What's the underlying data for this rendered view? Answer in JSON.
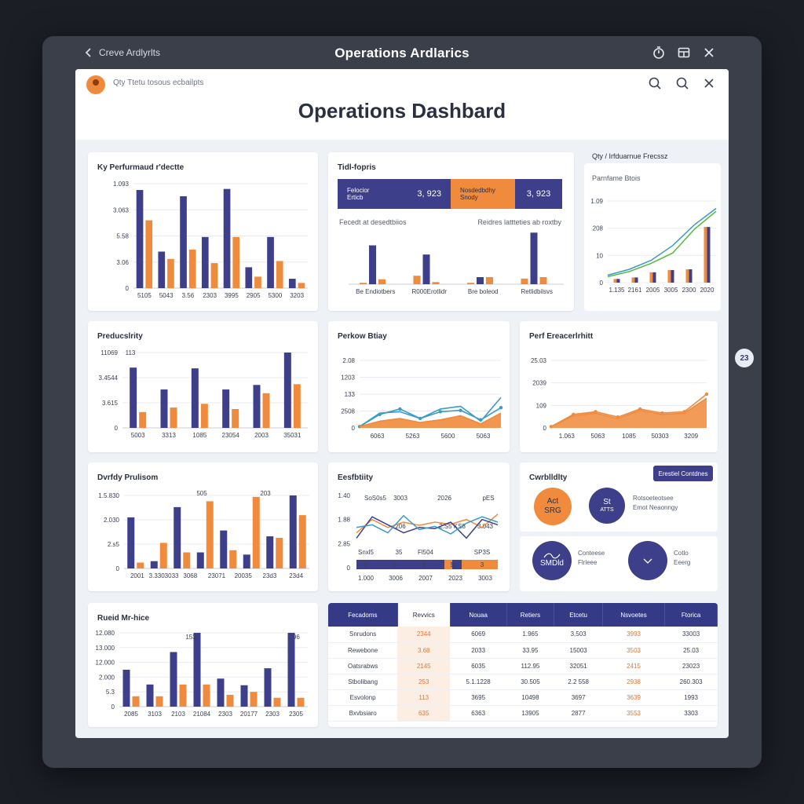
{
  "window": {
    "back_label": "Creve Ardlyrlts",
    "title": "Operations Ardlarics",
    "side_badge": "23"
  },
  "header": {
    "user_text": "Qty Ttetu tosous ecbailpts",
    "title": "Operations Dashbard"
  },
  "colors": {
    "navy": "#3d3f8a",
    "orange": "#f08a3c",
    "teal": "#3a9cc4",
    "green": "#58b83e",
    "window": "#3a3f4a",
    "canvas": "#eef1f6"
  },
  "panels": {
    "kpi": {
      "title": "Ky Perfurmaud r'dectte"
    },
    "tidl": {
      "title": "Tidl-fopris",
      "stat1_label": "Felocior\nErticb",
      "stat1_value": "3, 923",
      "stat2_label": "Nosdedbdhy\nSnody",
      "stat2_value": "3, 923",
      "sub_left": "Fecedt at desedtbiios",
      "sub_right": "Reidres lattteties ab roxtby"
    },
    "perf": {
      "header": "Qty / Irfduarnue Frecssz",
      "title": "Parnfame Btois"
    },
    "productivity": {
      "title": "Preducslrity"
    },
    "perkow": {
      "title": "Perkow Btiay"
    },
    "perfbreak": {
      "title": "Perf Ereacerlrhitt"
    },
    "dvridy": {
      "title": "Dvrfdy Prulisom"
    },
    "eesfoity": {
      "title": "Eesfbtiity"
    },
    "cwrbility": {
      "title": "Cwrblldlty",
      "button": "Erestiel Contdnes",
      "c1_line1": "Act",
      "c1_line2": "SRG",
      "c2_line1": "St",
      "c2_line2": "ATTS",
      "c2_text1": "Rotsoeteotsee",
      "c2_text2": "Emot Neaonngy",
      "c3_line1": "SMDld",
      "c3_text1": "Conteese",
      "c3_text2": "Flrleee",
      "c4_text1": "Cotlo",
      "c4_text2": "Eeerg"
    },
    "rued": {
      "title": "Rueid Mr-hice"
    }
  },
  "charts": [
    {
      "id": "kpi",
      "type": "bar",
      "yticks": [
        "1.093",
        "3.063",
        "5.58",
        "3.06",
        "0"
      ],
      "categories": [
        "5105",
        "5043",
        "3.56",
        "2303",
        "3995",
        "2905",
        "5300",
        "3203"
      ],
      "series": [
        {
          "values": [
            94,
            35,
            88,
            49,
            95,
            20,
            49,
            9
          ]
        },
        {
          "values": [
            65,
            28,
            37,
            24,
            49,
            11,
            26,
            5
          ]
        }
      ],
      "ylim": [
        0,
        100
      ]
    },
    {
      "id": "tidl",
      "type": "bar",
      "categories": [
        "Be Endiotbers",
        "R000Erotlidr",
        "Bre boleod",
        "Retlidbilsvs"
      ],
      "series": [
        {
          "values": [
            2,
            12,
            2,
            8
          ]
        },
        {
          "values": [
            55,
            42,
            10,
            73
          ]
        },
        {
          "values": [
            7,
            3,
            10,
            10
          ]
        }
      ],
      "ylim": [
        0,
        80
      ]
    },
    {
      "id": "perf",
      "type": "line+bar",
      "yticks": [
        "1.09",
        "208",
        "10",
        "0"
      ],
      "categories": [
        "1.135",
        "2161",
        "2005",
        "3005",
        "2300",
        "2020"
      ],
      "line_series": [
        {
          "values": [
            10,
            18,
            30,
            50,
            78,
            100
          ]
        },
        {
          "values": [
            8,
            15,
            26,
            40,
            72,
            96
          ]
        }
      ],
      "bar_series": [
        {
          "values": [
            5,
            7,
            14,
            17,
            18,
            75
          ]
        },
        {
          "values": [
            5,
            7,
            14,
            17,
            18,
            75
          ]
        }
      ],
      "ylim": [
        0,
        110
      ]
    },
    {
      "id": "productivity",
      "type": "bar",
      "yticks": [
        "11069",
        "3.4544",
        "3.615",
        "0"
      ],
      "extra_label": "113",
      "categories": [
        "5003",
        "3313",
        "1085",
        "23054",
        "2003",
        "35031"
      ],
      "series": [
        {
          "values": [
            80,
            51,
            79,
            51,
            57,
            100
          ]
        },
        {
          "values": [
            21,
            27,
            32,
            25,
            46,
            58
          ]
        }
      ],
      "ylim": [
        0,
        100
      ]
    },
    {
      "id": "perkow",
      "type": "area",
      "yticks": [
        "2.08",
        "1203",
        "133",
        "2508",
        "0"
      ],
      "categories": [
        "6063",
        "5263",
        "5600",
        "5063"
      ],
      "series": [
        {
          "values": [
            2,
            20,
            28,
            14,
            24,
            26,
            12,
            30
          ]
        },
        {
          "values": [
            2,
            22,
            24,
            14,
            28,
            32,
            10,
            45
          ]
        },
        {
          "values": [
            2,
            10,
            14,
            8,
            12,
            18,
            6,
            22
          ]
        }
      ],
      "ylim": [
        0,
        100
      ]
    },
    {
      "id": "perfbreak",
      "type": "area",
      "yticks": [
        "25.03",
        "2039",
        "109",
        "0"
      ],
      "categories": [
        "1.063",
        "5063",
        "1085",
        "50303",
        "3209"
      ],
      "series": [
        {
          "values": [
            2,
            18,
            22,
            14,
            26,
            20,
            22,
            44
          ]
        },
        {
          "values": [
            2,
            20,
            24,
            16,
            28,
            22,
            24,
            50
          ]
        }
      ],
      "ylim": [
        0,
        100
      ]
    },
    {
      "id": "dvridy",
      "type": "bar",
      "yticks": [
        "1.5.830",
        "2.030",
        "2.s5",
        "0"
      ],
      "top_labels": [
        "505",
        "203"
      ],
      "categories": [
        "2001",
        "3.3303033",
        "3068",
        "23071",
        "20035",
        "23d3",
        "23d4"
      ],
      "series": [
        {
          "values": [
            70,
            10,
            84,
            22,
            52,
            19,
            44,
            100
          ]
        },
        {
          "values": [
            8,
            35,
            22,
            92,
            25,
            98,
            42,
            73
          ]
        }
      ],
      "ylim": [
        0,
        100
      ]
    },
    {
      "id": "eesfoity",
      "type": "multiline",
      "yticks": [
        "1.40",
        "1.88",
        "2.85",
        "0"
      ],
      "top_labels": [
        "SoS0s5",
        "3003",
        "2026",
        "pES"
      ],
      "mid_labels": [
        "206",
        "2.S5 KS8",
        "3.043"
      ],
      "categories": [
        "1.000",
        "3006",
        "2007",
        "2023",
        "3003"
      ],
      "strip_labels": [
        "$",
        "3",
        "$",
        "$",
        "3"
      ],
      "series": [
        {
          "values": [
            30,
            55,
            40,
            50,
            44,
            50,
            46,
            55,
            40,
            65
          ]
        },
        {
          "values": [
            20,
            60,
            45,
            30,
            40,
            38,
            50,
            20,
            55,
            45
          ]
        },
        {
          "values": [
            40,
            45,
            30,
            62,
            36,
            42,
            28,
            48,
            60,
            50
          ]
        }
      ],
      "ylim": [
        0,
        100
      ],
      "sub_labels": [
        "Snxl5",
        "35",
        "Fl504",
        "SP3S"
      ]
    },
    {
      "id": "rued",
      "type": "bar",
      "yticks": [
        "12.080",
        "13.000",
        "12.000",
        "2.000",
        "5.3",
        "0"
      ],
      "top_labels": [
        "153",
        "2.96"
      ],
      "categories": [
        "2085",
        "3103",
        "2103",
        "21084",
        "2303",
        "20177",
        "2303",
        "2305"
      ],
      "series": [
        {
          "values": [
            50,
            30,
            74,
            100,
            38,
            29,
            52,
            100
          ]
        },
        {
          "values": [
            14,
            14,
            30,
            30,
            16,
            20,
            12,
            12
          ]
        }
      ],
      "ylim": [
        0,
        100
      ]
    }
  ],
  "table": {
    "headers": [
      "Fecadoms",
      "Revvics",
      "Nouaa",
      "Retiers",
      "Etcetu",
      "Nsvoetes",
      "Ftorica"
    ],
    "rows": [
      [
        "Snrudons",
        "2344",
        "6069",
        "1.965",
        "3,503",
        "3993",
        "33003"
      ],
      [
        "Rewebone",
        "3.68",
        "2033",
        "33.95",
        "15003",
        "3503",
        "25.03"
      ],
      [
        "Oatsrabws",
        "2145",
        "6035",
        "112.95",
        "32051",
        "2415",
        "23023"
      ],
      [
        "Stbolibang",
        "253",
        "5.1.1228",
        "30.505",
        "2.2 558",
        "2938",
        "260.303"
      ],
      [
        "Esvolonp",
        "113",
        "3695",
        "10498",
        "3697",
        "3639",
        "1993"
      ],
      [
        "Bxvbsiaro",
        "635",
        "6363",
        "13905",
        "2877",
        "3553",
        "3303"
      ]
    ]
  }
}
